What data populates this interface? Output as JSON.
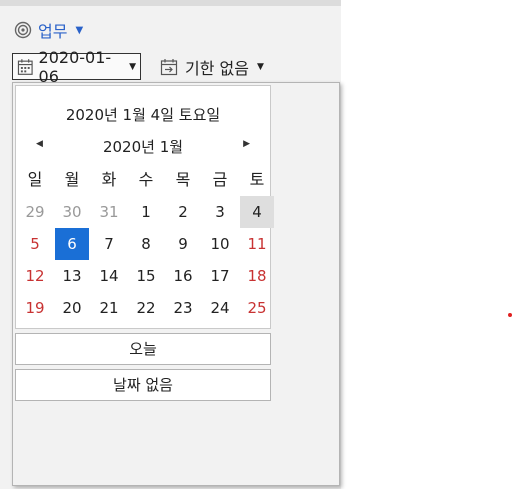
{
  "category": {
    "label": "업무",
    "color": "#2a62c9",
    "icon": "target-icon"
  },
  "start_date": {
    "value": "2020-01-06",
    "icon": "calendar-icon"
  },
  "due_date": {
    "label": "기한 없음",
    "icon": "calendar-arrow-icon"
  },
  "calendar": {
    "today_heading": "2020년 1월 4일 토요일",
    "month_title": "2020년 1월",
    "weekdays": [
      "일",
      "월",
      "화",
      "수",
      "목",
      "금",
      "토"
    ],
    "weeks": [
      [
        "29",
        "30",
        "31",
        "1",
        "2",
        "3",
        "4"
      ],
      [
        "5",
        "6",
        "7",
        "8",
        "9",
        "10",
        "11"
      ],
      [
        "12",
        "13",
        "14",
        "15",
        "16",
        "17",
        "18"
      ],
      [
        "19",
        "20",
        "21",
        "22",
        "23",
        "24",
        "25"
      ]
    ],
    "selected_color": "#1a6fd6",
    "weekend_color": "#c83232"
  },
  "buttons": {
    "today": "오늘",
    "no_date": "날짜 없음"
  }
}
